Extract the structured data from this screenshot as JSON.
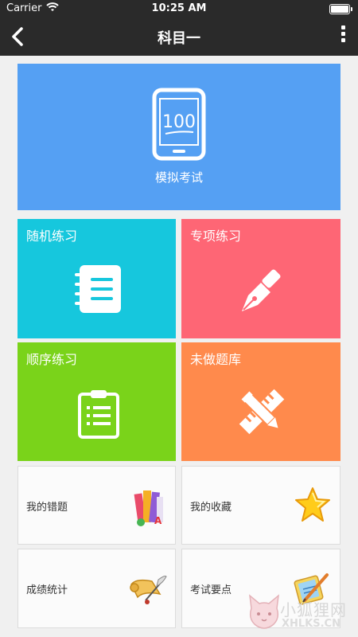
{
  "status_bar": {
    "carrier": "Carrier",
    "time": "10:25 AM"
  },
  "nav": {
    "title": "科目一",
    "back_icon": "chevron-left-icon",
    "more_icon": "more-vertical-icon"
  },
  "hero": {
    "label": "模拟考试",
    "icon": "phone-exam-icon",
    "icon_text": "100",
    "color": "#55a0f3"
  },
  "practice_tiles": [
    {
      "label": "随机练习",
      "icon": "notebook-icon",
      "color": "#16c7dd"
    },
    {
      "label": "专项练习",
      "icon": "pen-nib-icon",
      "color": "#fe6675"
    },
    {
      "label": "顺序练习",
      "icon": "clipboard-icon",
      "color": "#7ad31a"
    },
    {
      "label": "未做题库",
      "icon": "ruler-pencil-icon",
      "color": "#ff8a4c"
    }
  ],
  "cards": [
    {
      "label": "我的错题",
      "icon": "books-icon"
    },
    {
      "label": "我的收藏",
      "icon": "star-icon"
    },
    {
      "label": "成绩统计",
      "icon": "scroll-quill-icon"
    },
    {
      "label": "考试要点",
      "icon": "notepad-pencil-icon"
    }
  ],
  "watermark": {
    "text_cn": "小狐狸网",
    "text_en": "XHLKS.CN"
  }
}
